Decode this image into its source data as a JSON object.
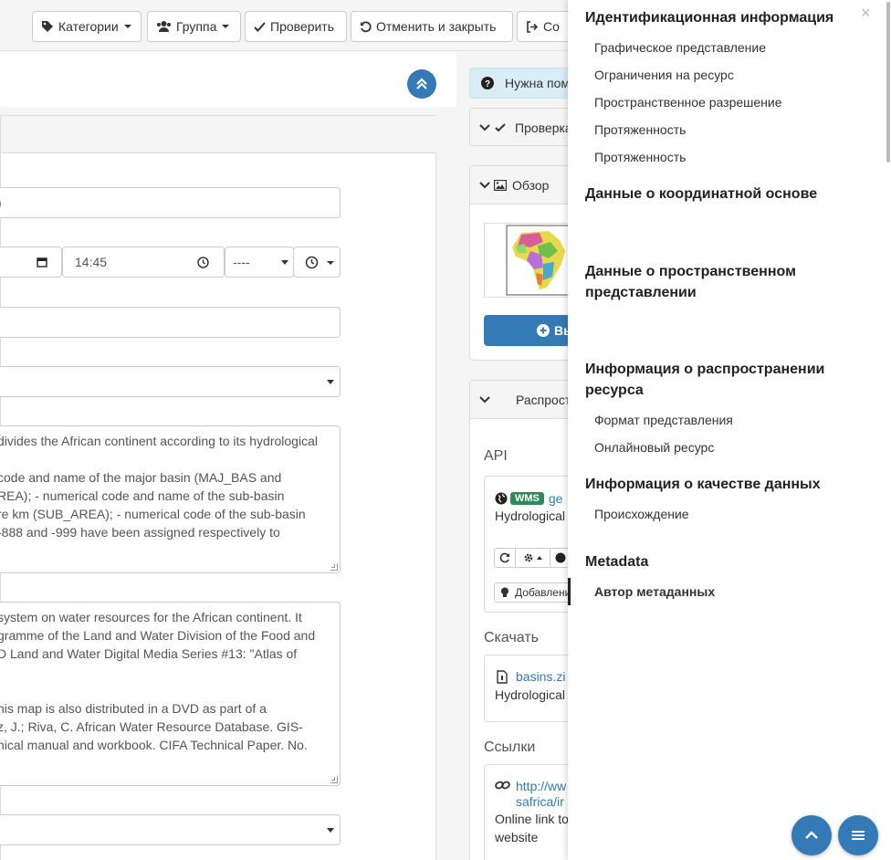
{
  "toolbar": {
    "categories_label": "Категории",
    "group_label": "Группа",
    "validate_label": "Проверить",
    "cancel_close_label": "Отменить и закрыть",
    "save_label": "Со"
  },
  "form": {
    "title_value": ")",
    "time_value": "14:45",
    "ampm_value": "----",
    "abstract_lines": [
      "divides the African continent according to its hydrological",
      "",
      "code and name of the major basin (MAJ_BAS and",
      "REA); - numerical code and name of the sub-basin",
      "re km (SUB_AREA); - numerical code of the sub-basin",
      " -888 and -999 have been assigned respectively to"
    ],
    "purpose_lines": [
      "system on water resources for the African continent. It",
      "gramme of the Land and Water Division of the Food and",
      "D Land and Water Digital Media Series #13: \"Atlas of",
      "",
      "",
      "his map is also distributed in a DVD as part of a",
      "z, J.; Riva, C. African Water Resource Database. GIS-",
      "nical manual and workbook. CIFA Technical Paper. No."
    ]
  },
  "right": {
    "help_label": "Нужна пом",
    "validation_label": "Проверка",
    "overview_label": "Обзор",
    "overview_button": "Вы",
    "distribution_label": "Распрост",
    "api_label": "API",
    "wms_badge": "WMS",
    "api_link": "ge",
    "api_desc": "Hydrological",
    "api_add_label": "Добавлени",
    "download_label": "Скачать",
    "download_link": "basins.zi",
    "download_desc": "Hydrological",
    "links_label": "Ссылки",
    "links_link_1": "http://ww",
    "links_link_2": "safrica/ir",
    "links_desc_1": "Online link to",
    "links_desc_2": "website"
  },
  "drawer": {
    "sections": [
      {
        "title": "Идентификационная информация",
        "items": [
          "Графическое представление",
          "Ограничения на ресурс",
          "Пространственное разрешение",
          "Протяженность",
          "Протяженность"
        ]
      },
      {
        "title": "Данные о координатной основе",
        "items": []
      },
      {
        "title": "Данные о пространственном представлении",
        "items": []
      },
      {
        "title": "Информация о распространении ресурса",
        "items": [
          "Формат представления",
          "Онлайновый ресурс"
        ]
      },
      {
        "title": "Информация о качестве данных",
        "items": [
          "Происхождение"
        ]
      },
      {
        "title": "Metadata",
        "items": [
          "Автор метаданных"
        ]
      }
    ],
    "close_label": "×"
  },
  "colors": {
    "primary": "#337ab7",
    "wms_badge": "#2e8b57"
  }
}
